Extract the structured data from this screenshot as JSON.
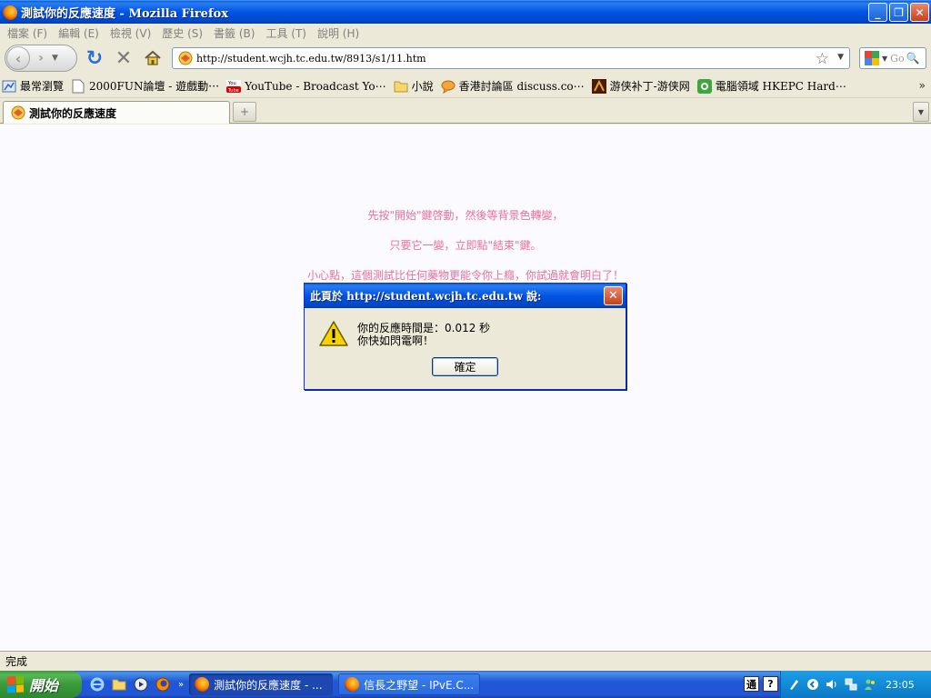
{
  "window": {
    "title": "測試你的反應速度 - Mozilla Firefox",
    "controls": [
      "minimize",
      "restore",
      "close"
    ]
  },
  "menu": [
    "檔案 (F)",
    "編輯 (E)",
    "檢視 (V)",
    "歷史 (S)",
    "書籤 (B)",
    "工具 (T)",
    "說明 (H)"
  ],
  "nav": {
    "url": "http://student.wcjh.tc.edu.tw/8913/s1/11.htm",
    "search_placeholder": "Go"
  },
  "bookmarks": [
    {
      "label": "最常瀏覽",
      "icon": "most-visited-icon"
    },
    {
      "label": "2000FUN論壇 - 遊戲動⋯",
      "icon": "page-icon"
    },
    {
      "label": "YouTube - Broadcast Yo⋯",
      "icon": "youtube-icon"
    },
    {
      "label": "小說",
      "icon": "folder-icon"
    },
    {
      "label": "香港討論區 discuss.co⋯",
      "icon": "chat-icon"
    },
    {
      "label": "游侠补丁-游侠网",
      "icon": "ali213-icon"
    },
    {
      "label": "電腦領域 HKEPC Hard⋯",
      "icon": "hkepc-icon"
    }
  ],
  "tab": {
    "label": "測試你的反應速度"
  },
  "page": {
    "line1": "先按\"開始\"鍵啓動，然後等背景色轉變，",
    "line2": "只要它一變，立即點\"結束\"鍵。",
    "line3": "小心點，這個測試比任何藥物更能令你上癮，你試過就會明白了！",
    "text_color": "#e8709c",
    "background": "#fafaff"
  },
  "dialog": {
    "title": "此頁於 http://student.wcjh.tc.edu.tw 說:",
    "message_line1": "你的反應時間是：0.012 秒",
    "message_line2": "你快如閃電啊！",
    "ok_label": "確定"
  },
  "status": {
    "text": "完成"
  },
  "taskbar": {
    "start_label": "開始",
    "tasks": [
      {
        "label": "測試你的反應速度 - ...",
        "active": true
      },
      {
        "label": "信長之野望 - IPvE.C...",
        "active": false
      }
    ],
    "ime": [
      "通",
      "?"
    ],
    "clock": "23:05"
  }
}
